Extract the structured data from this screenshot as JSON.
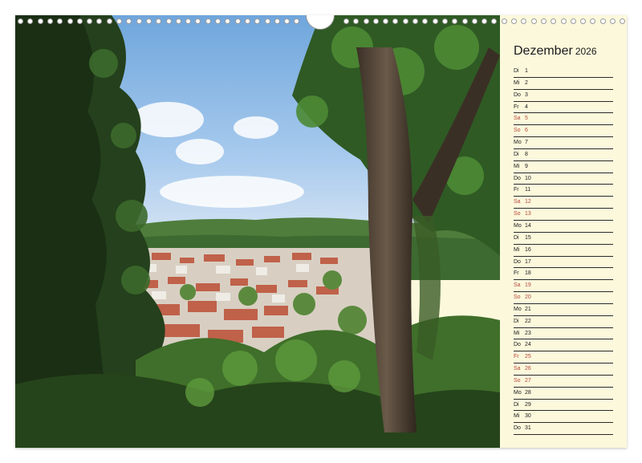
{
  "calendar": {
    "month": "Dezember",
    "year": "2026",
    "days": [
      {
        "wd": "Di",
        "d": "1",
        "weekend": false
      },
      {
        "wd": "Mi",
        "d": "2",
        "weekend": false
      },
      {
        "wd": "Do",
        "d": "3",
        "weekend": false
      },
      {
        "wd": "Fr",
        "d": "4",
        "weekend": false
      },
      {
        "wd": "Sa",
        "d": "5",
        "weekend": true
      },
      {
        "wd": "So",
        "d": "6",
        "weekend": true
      },
      {
        "wd": "Mo",
        "d": "7",
        "weekend": false
      },
      {
        "wd": "Di",
        "d": "8",
        "weekend": false
      },
      {
        "wd": "Mi",
        "d": "9",
        "weekend": false
      },
      {
        "wd": "Do",
        "d": "10",
        "weekend": false
      },
      {
        "wd": "Fr",
        "d": "11",
        "weekend": false
      },
      {
        "wd": "Sa",
        "d": "12",
        "weekend": true
      },
      {
        "wd": "So",
        "d": "13",
        "weekend": true
      },
      {
        "wd": "Mo",
        "d": "14",
        "weekend": false
      },
      {
        "wd": "Di",
        "d": "15",
        "weekend": false
      },
      {
        "wd": "Mi",
        "d": "16",
        "weekend": false
      },
      {
        "wd": "Do",
        "d": "17",
        "weekend": false
      },
      {
        "wd": "Fr",
        "d": "18",
        "weekend": false
      },
      {
        "wd": "Sa",
        "d": "19",
        "weekend": true
      },
      {
        "wd": "So",
        "d": "20",
        "weekend": true
      },
      {
        "wd": "Mo",
        "d": "21",
        "weekend": false
      },
      {
        "wd": "Di",
        "d": "22",
        "weekend": false
      },
      {
        "wd": "Mi",
        "d": "23",
        "weekend": false
      },
      {
        "wd": "Do",
        "d": "24",
        "weekend": false
      },
      {
        "wd": "Fr",
        "d": "25",
        "weekend": true
      },
      {
        "wd": "Sa",
        "d": "26",
        "weekend": true
      },
      {
        "wd": "So",
        "d": "27",
        "weekend": true
      },
      {
        "wd": "Mo",
        "d": "28",
        "weekend": false
      },
      {
        "wd": "Di",
        "d": "29",
        "weekend": false
      },
      {
        "wd": "Mi",
        "d": "30",
        "weekend": false
      },
      {
        "wd": "Do",
        "d": "31",
        "weekend": false
      }
    ]
  },
  "colors": {
    "paper": "#fcf8dc",
    "weekend_text": "#b5483c",
    "text": "#1a1a1a"
  }
}
